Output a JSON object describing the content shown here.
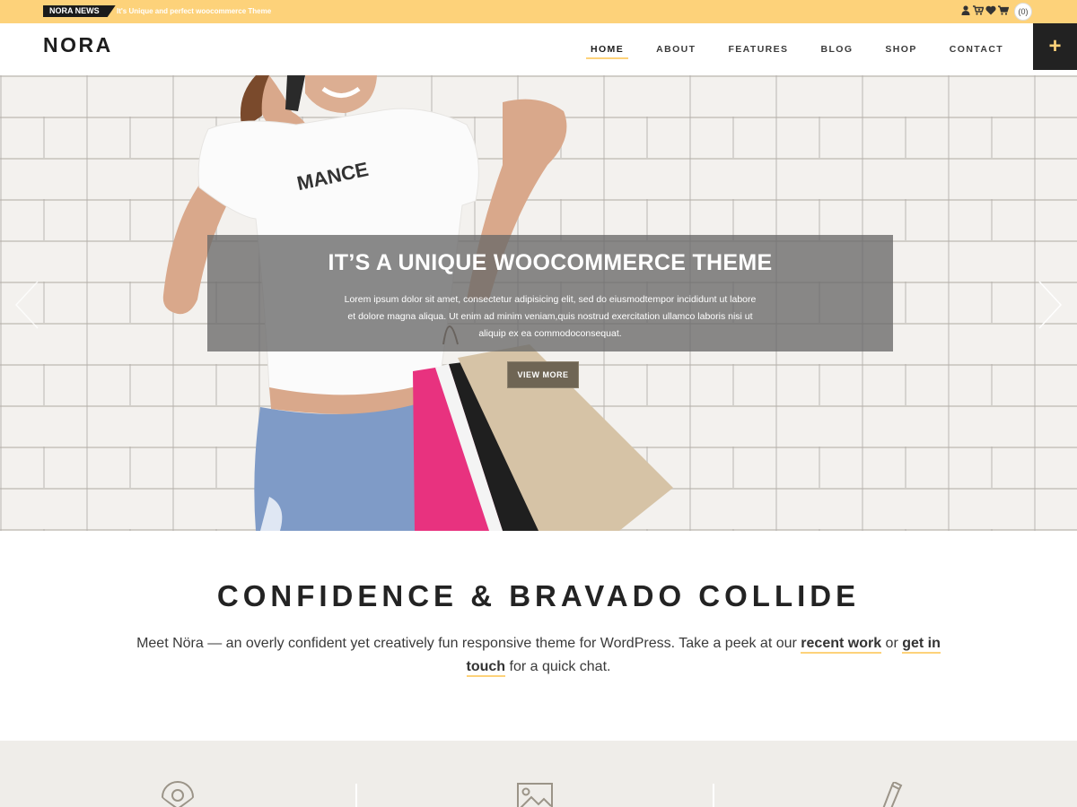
{
  "topbar": {
    "news_tag": "NORA NEWS",
    "news_text": "It's Unique and perfect woocommerce Theme",
    "cart_count": "(0)",
    "icons": [
      "user-icon",
      "cart-plus-icon",
      "heart-icon",
      "cart-icon"
    ]
  },
  "header": {
    "logo": "NORA",
    "nav": [
      "HOME",
      "ABOUT",
      "FEATURES",
      "BLOG",
      "SHOP",
      "CONTACT"
    ],
    "active_nav": "HOME",
    "plus_label": "+"
  },
  "hero": {
    "title": "IT’S A UNIQUE WOOCOMMERCE THEME",
    "text": "Lorem ipsum dolor sit amet, consectetur adipisicing elit, sed do eiusmodtempor incididunt ut labore et dolore magna aliqua. Ut enim ad minim veniam,quis nostrud exercitation ullamco laboris nisi ut aliquip ex ea commodoconsequat.",
    "button": "VIEW MORE",
    "shirt_text": "MANCE"
  },
  "intro": {
    "title": "CONFIDENCE & BRAVADO COLLIDE",
    "text_before": "Meet Nöra — an overly confident yet creatively fun responsive theme for WordPress. Take a peek at our ",
    "link1": "recent work",
    "text_mid": " or ",
    "link2": "get in touch",
    "text_after": " for a quick chat."
  },
  "features": {
    "icons": [
      "location-pin-icon",
      "image-icon",
      "pencil-icon"
    ]
  },
  "colors": {
    "accent": "#fdd27a",
    "dark": "#222222",
    "features_bg": "#efede9"
  }
}
